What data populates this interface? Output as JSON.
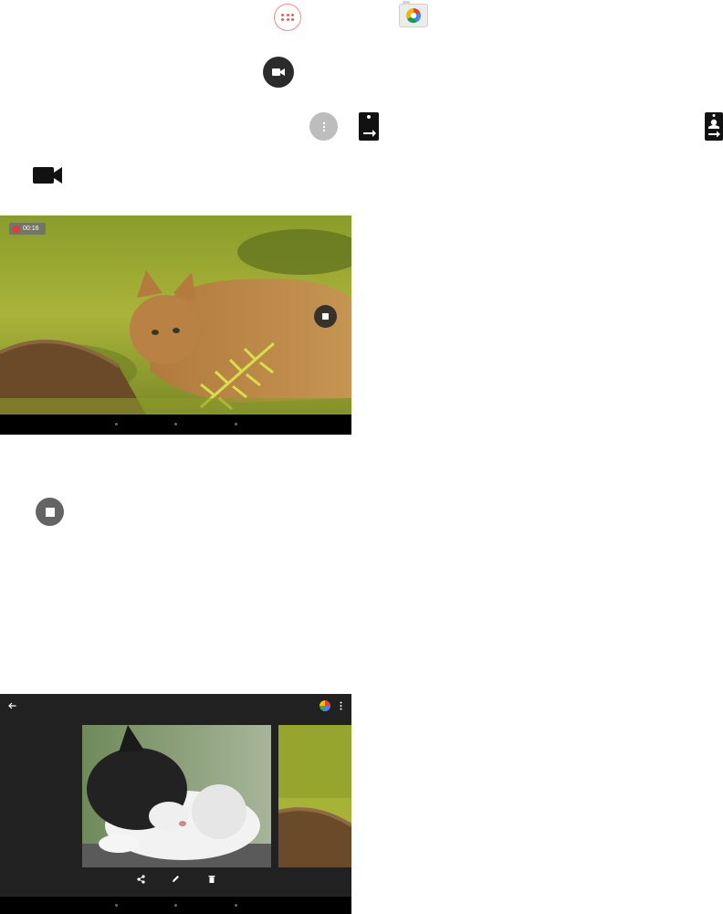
{
  "recording": {
    "timer": "00:16"
  },
  "icons": {
    "apps": "apps-drawer-icon",
    "camera_app": "camera-app-icon",
    "video_mode": "videocam-icon",
    "more": "more-vert-icon",
    "switch_front": "switch-camera-icon",
    "switch_rear": "switch-camera-icon",
    "stop": "stop-icon",
    "back": "arrow-back-icon",
    "photos": "pinwheel-icon",
    "share": "share-icon",
    "edit": "pencil-icon",
    "delete": "trash-icon"
  },
  "colors": {
    "record_dot": "#e53935",
    "apps_accent": "#e06060",
    "dark_button": "#2b2b2b",
    "gallery_bg": "#212121"
  }
}
